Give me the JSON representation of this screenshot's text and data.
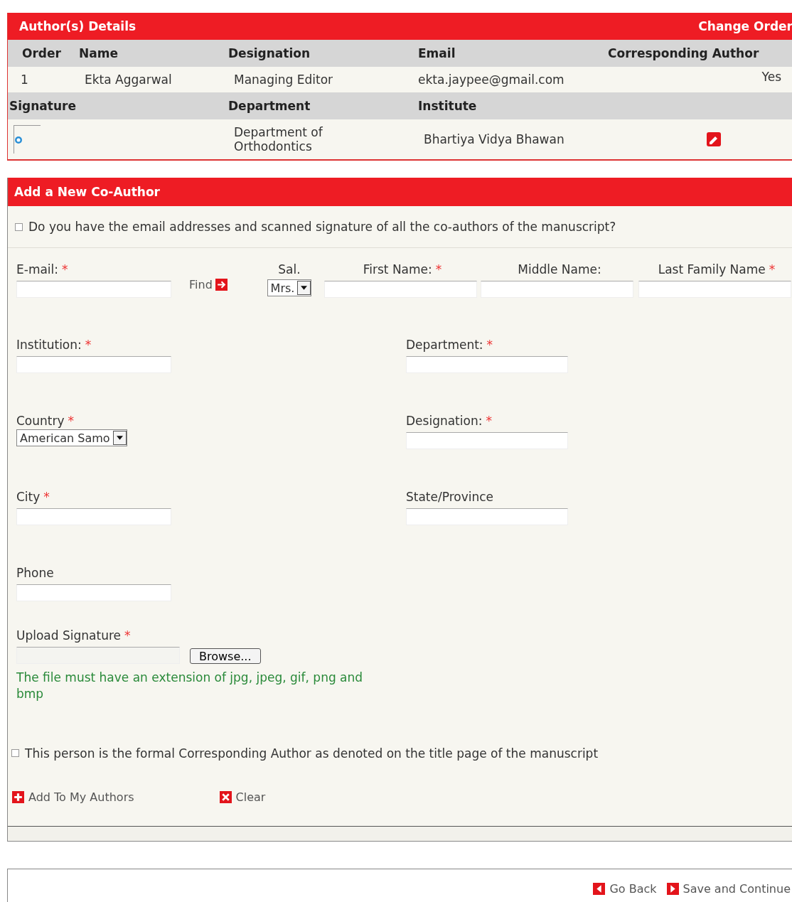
{
  "authors": {
    "title": "Author(s) Details",
    "change_order": "Change Order",
    "columns": [
      "Order",
      "Name",
      "Designation",
      "Email",
      "Corresponding Author"
    ],
    "columns_2": [
      "Signature",
      "Department",
      "Institute"
    ],
    "rows": [
      {
        "order": "1",
        "name": "Ekta Aggarwal",
        "designation": "Managing Editor",
        "email": "ekta.jaypee@gmail.com",
        "corresponding": "Yes",
        "department": "Department of Orthodontics",
        "institute": "Bhartiya Vidya Bhawan"
      }
    ]
  },
  "co_author": {
    "title": "Add a New Co-Author",
    "confirm": {
      "label": "Do you have the email addresses and scanned signature of all the co-authors of the manuscript?",
      "checked": false
    },
    "identity_fields": [
      {
        "kind": "email",
        "label": "E-mail:",
        "mark": "*",
        "find_label": "Find"
      },
      {
        "kind": "select",
        "label": "Sal.",
        "value": "Mrs."
      },
      {
        "kind": "text",
        "label": "First Name:",
        "mark": "*"
      },
      {
        "kind": "text",
        "label": "Middle Name:"
      },
      {
        "kind": "text",
        "label": "Last Family Name",
        "mark": "*"
      }
    ],
    "detail_rows": [
      [
        {
          "kind": "text",
          "label": "Institution:",
          "mark": "*"
        },
        {
          "kind": "text",
          "label": "Department:",
          "mark": "*"
        }
      ],
      [
        {
          "kind": "select",
          "label": "Country",
          "mark": "*",
          "value": "American Samo"
        },
        {
          "kind": "text",
          "label": "Designation:",
          "mark": "*"
        }
      ],
      [
        {
          "kind": "text",
          "label": "City",
          "mark": "*"
        },
        {
          "kind": "text",
          "label": "State/Province"
        }
      ],
      [
        {
          "kind": "text",
          "label": "Phone"
        }
      ],
      [
        {
          "kind": "file",
          "label": "Upload Signature",
          "mark": "*",
          "button": "Browse...",
          "hint": "The file must have an extension of jpg, jpeg, gif, png and bmp"
        }
      ]
    ],
    "corresponding": {
      "label": "This person is the formal Corresponding Author as denoted on the title page of the manuscript",
      "checked": false
    },
    "actions": [
      {
        "kind": "add",
        "label": "Add To My Authors"
      },
      {
        "kind": "clear",
        "label": "Clear"
      }
    ]
  },
  "footer": {
    "actions": [
      {
        "kind": "back",
        "label": "Go Back"
      },
      {
        "kind": "next",
        "label": "Save and Continue"
      }
    ]
  }
}
